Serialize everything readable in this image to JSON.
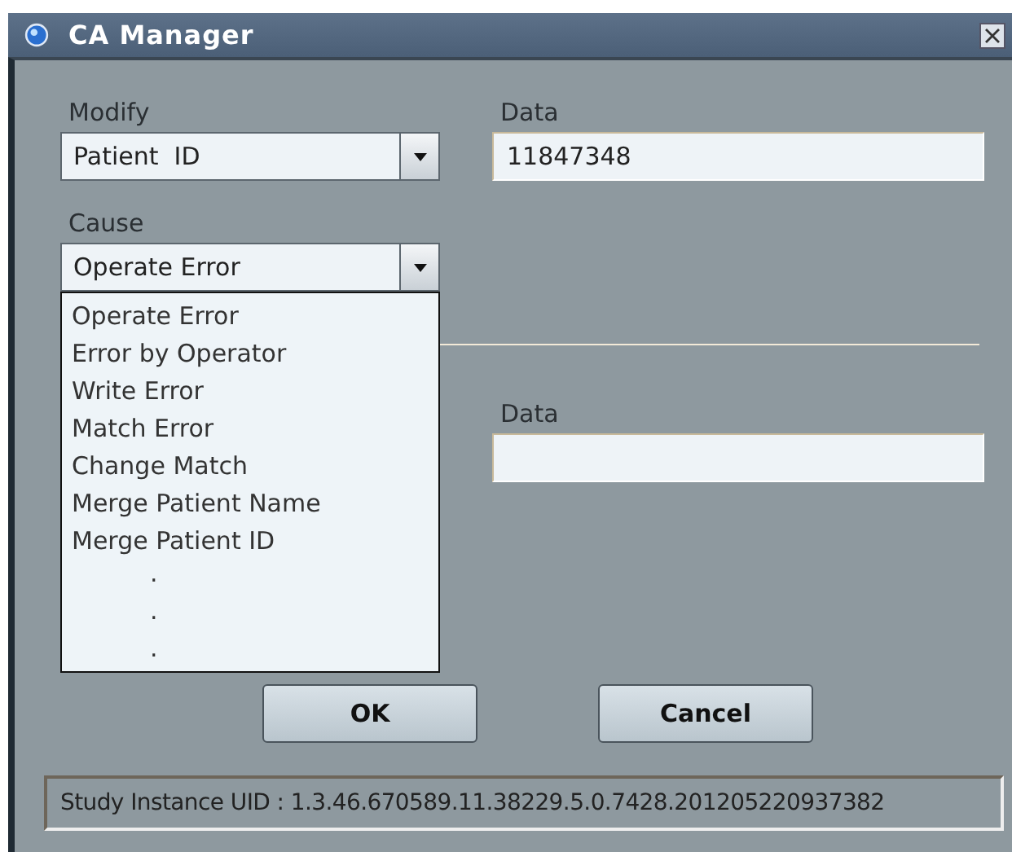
{
  "window": {
    "title": "CA Manager"
  },
  "modify": {
    "label": "Modify",
    "value": "Patient  ID"
  },
  "data": {
    "label": "Data",
    "value": "11847348"
  },
  "cause": {
    "label": "Cause",
    "value": "Operate Error",
    "expanded": true,
    "options": [
      "Operate Error",
      "Error by Operator",
      "Write Error",
      "Match Error",
      "Change Match",
      "Merge Patient Name",
      "Merge Patient ID",
      ".",
      ".",
      "."
    ]
  },
  "data2": {
    "label": "Data"
  },
  "buttons": [
    "OK",
    "Cancel"
  ],
  "status_bar": "Study Instance UID : 1.3.46.670589.11.38229.5.0.7428.201205220937382"
}
